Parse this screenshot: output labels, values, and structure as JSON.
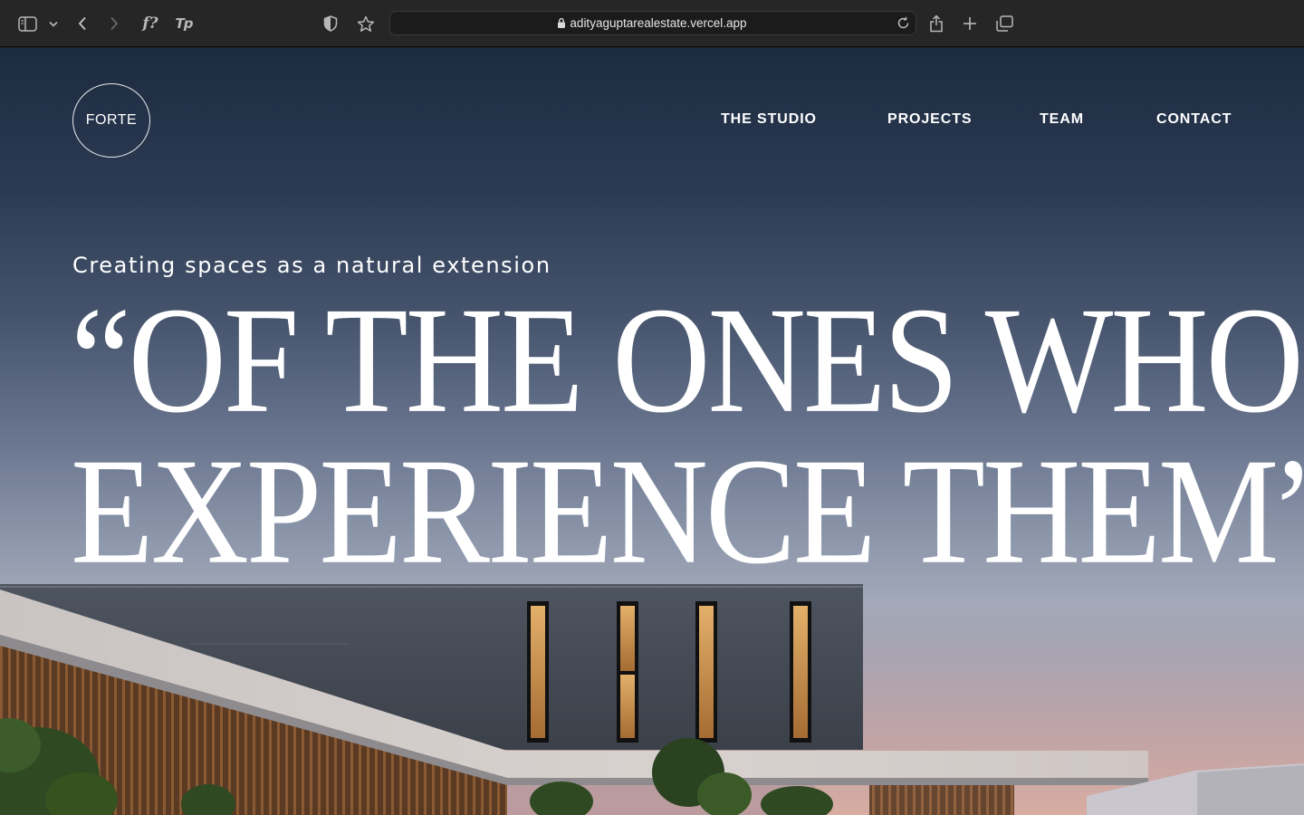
{
  "browser": {
    "url": "adityaguptarealestate.vercel.app",
    "icons": {
      "sidebar": "sidebar-icon",
      "sidebar_menu": "chevron-down-icon",
      "back": "back-icon",
      "forward": "forward-icon",
      "extension_1": "f?",
      "extension_2": "Tp",
      "privacy": "shield-icon",
      "bookmark": "star-icon",
      "lock": "lock-icon",
      "reload": "reload-icon",
      "share": "share-icon",
      "new_tab": "plus-icon",
      "tabs": "tabs-overview-icon"
    }
  },
  "site": {
    "logo": "FORTE",
    "nav": [
      {
        "label": "THE STUDIO"
      },
      {
        "label": "PROJECTS"
      },
      {
        "label": "TEAM"
      },
      {
        "label": "CONTACT"
      }
    ],
    "hero": {
      "tagline": "Creating spaces as a natural extension",
      "headline_line1": "“OF THE ONES WHO",
      "headline_line2": "EXPERIENCE THEM”",
      "image": "modern building at dusk"
    }
  },
  "colors": {
    "chrome_bg": "#262626",
    "accent_extension": "#3b8bdc",
    "hero_text": "#ffffff"
  }
}
